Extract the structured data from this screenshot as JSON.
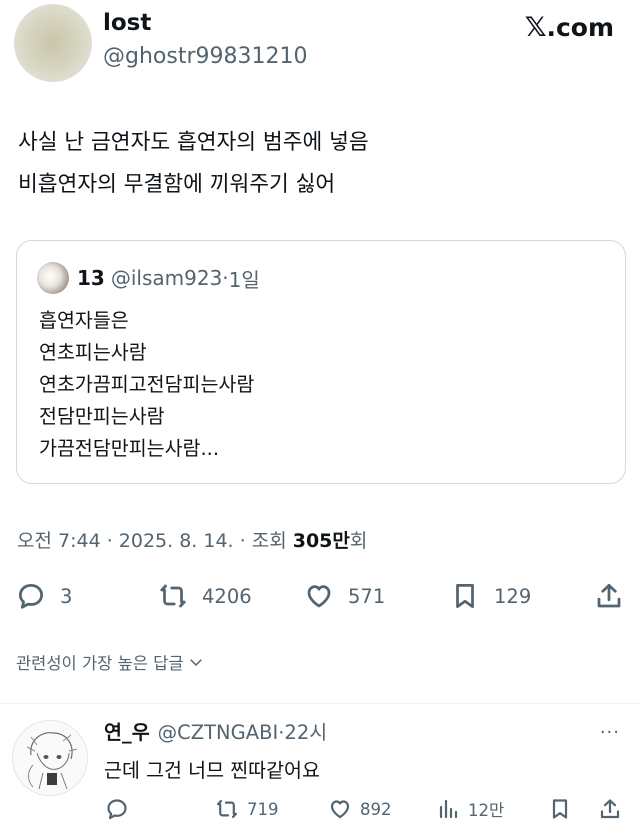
{
  "header": {
    "display_name": "lost",
    "handle": "@ghostr99831210",
    "site_label": ".com"
  },
  "tweet": {
    "lines": [
      "사실 난 금연자도 흡연자의 범주에 넣음",
      "비흡연자의 무결함에 끼워주기 싫어"
    ]
  },
  "quote": {
    "name": "13",
    "handle": "@ilsam923",
    "sep": "·",
    "time": "1일",
    "lines": [
      "흡연자들은",
      "연초피는사람",
      "연초가끔피고전담피는사람",
      "전담만피는사람",
      "가끔전담만피는사람..."
    ]
  },
  "meta": {
    "time_date": "오전 7:44 · 2025. 8. 14. · 조회 ",
    "views": "305만",
    "views_suffix": "회"
  },
  "stats": {
    "replies": "3",
    "reposts": "4206",
    "likes": "571",
    "bookmarks": "129"
  },
  "sort": {
    "label": "관련성이 가장 높은 답글"
  },
  "reply": {
    "name": "연_우",
    "handle": "@CZTNGABI",
    "sep": "·",
    "time": "22시",
    "text": "근데 그건 너므 찐따같어요",
    "more": "···",
    "reposts": "719",
    "likes": "892",
    "views": "12만"
  }
}
